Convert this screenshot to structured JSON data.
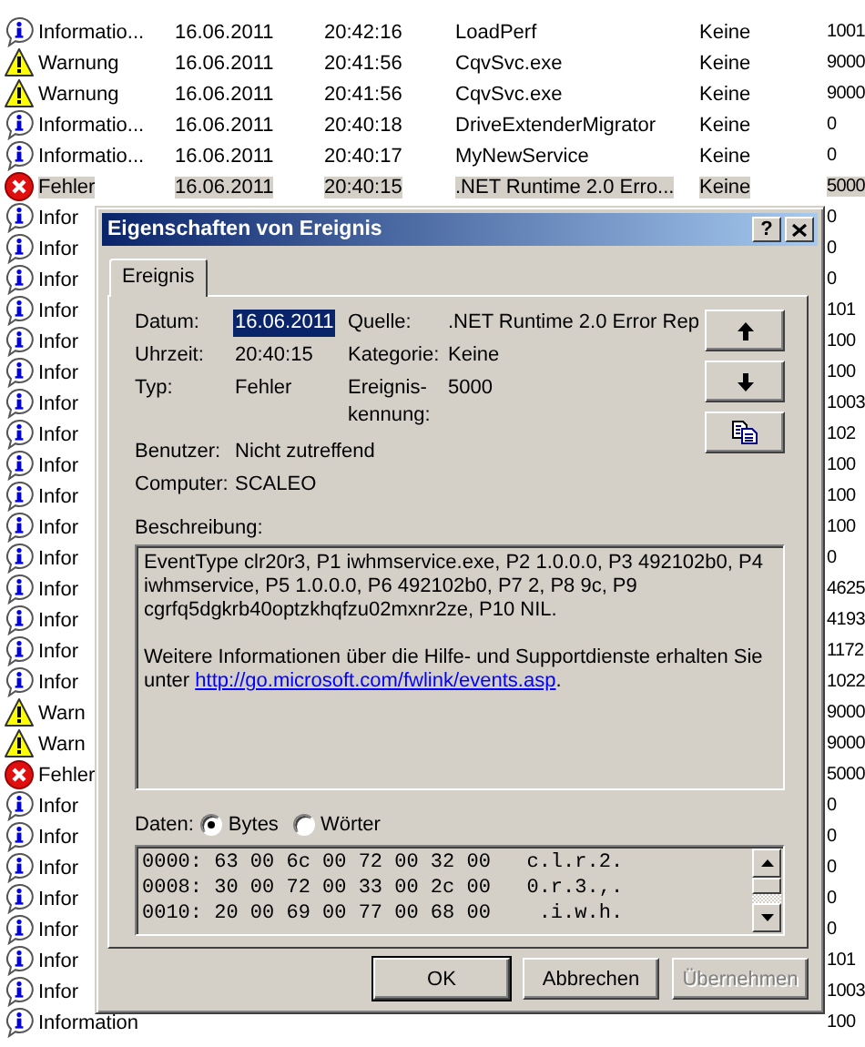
{
  "event_list": {
    "rows": [
      {
        "kind": "info",
        "type": "Informatio...",
        "date": "16.06.2011",
        "time": "20:42:16",
        "source": "LoadPerf",
        "category": "Keine",
        "id": "1001",
        "selected": false
      },
      {
        "kind": "warning",
        "type": "Warnung",
        "date": "16.06.2011",
        "time": "20:41:56",
        "source": "CqvSvc.exe",
        "category": "Keine",
        "id": "9000",
        "selected": false
      },
      {
        "kind": "warning",
        "type": "Warnung",
        "date": "16.06.2011",
        "time": "20:41:56",
        "source": "CqvSvc.exe",
        "category": "Keine",
        "id": "9000",
        "selected": false
      },
      {
        "kind": "info",
        "type": "Informatio...",
        "date": "16.06.2011",
        "time": "20:40:18",
        "source": "DriveExtenderMigrator",
        "category": "Keine",
        "id": "0",
        "selected": false
      },
      {
        "kind": "info",
        "type": "Informatio...",
        "date": "16.06.2011",
        "time": "20:40:17",
        "source": "MyNewService",
        "category": "Keine",
        "id": "0",
        "selected": false
      },
      {
        "kind": "error",
        "type": "Fehler",
        "date": "16.06.2011",
        "time": "20:40:15",
        "source": ".NET Runtime 2.0 Erro...",
        "category": "Keine",
        "id": "5000",
        "selected": true
      },
      {
        "kind": "info",
        "type": "Infor",
        "id": "0",
        "selected": false
      },
      {
        "kind": "info",
        "type": "Infor",
        "id": "0",
        "selected": false
      },
      {
        "kind": "info",
        "type": "Infor",
        "id": "0",
        "selected": false
      },
      {
        "kind": "info",
        "type": "Infor",
        "id": "101",
        "selected": false
      },
      {
        "kind": "info",
        "type": "Infor",
        "id": "100",
        "selected": false
      },
      {
        "kind": "info",
        "type": "Infor",
        "id": "100",
        "selected": false
      },
      {
        "kind": "info",
        "type": "Infor",
        "id": "1003",
        "selected": false
      },
      {
        "kind": "info",
        "type": "Infor",
        "id": "102",
        "selected": false
      },
      {
        "kind": "info",
        "type": "Infor",
        "id": "100",
        "selected": false
      },
      {
        "kind": "info",
        "type": "Infor",
        "id": "100",
        "selected": false
      },
      {
        "kind": "info",
        "type": "Infor",
        "id": "100",
        "selected": false
      },
      {
        "kind": "info",
        "type": "Infor",
        "id": "0",
        "selected": false
      },
      {
        "kind": "info",
        "type": "Infor",
        "id": "4625",
        "selected": false
      },
      {
        "kind": "info",
        "type": "Infor",
        "id": "4193",
        "selected": false
      },
      {
        "kind": "info",
        "type": "Infor",
        "id": "1172",
        "selected": false
      },
      {
        "kind": "info",
        "type": "Infor",
        "id": "1022",
        "selected": false
      },
      {
        "kind": "warning",
        "type": "Warn",
        "id": "9000",
        "selected": false
      },
      {
        "kind": "warning",
        "type": "Warn",
        "id": "9000",
        "selected": false
      },
      {
        "kind": "error",
        "type": "Fehler",
        "id": "5000",
        "selected": false
      },
      {
        "kind": "info",
        "type": "Infor",
        "id": "0",
        "selected": false
      },
      {
        "kind": "info",
        "type": "Infor",
        "id": "0",
        "selected": false
      },
      {
        "kind": "info",
        "type": "Infor",
        "id": "0",
        "selected": false
      },
      {
        "kind": "info",
        "type": "Infor",
        "id": "0",
        "selected": false
      },
      {
        "kind": "info",
        "type": "Infor",
        "id": "0",
        "selected": false
      },
      {
        "kind": "info",
        "type": "Infor",
        "id": "101",
        "selected": false
      },
      {
        "kind": "info",
        "type": "Infor",
        "id": "1003",
        "selected": false
      },
      {
        "kind": "info",
        "type": "Information",
        "id": "100",
        "selected": false
      }
    ]
  },
  "dialog": {
    "title": "Eigenschaften von Ereignis",
    "title_buttons": [
      {
        "kind": "help",
        "glyph": "?"
      },
      {
        "kind": "close"
      }
    ],
    "tabs": [
      {
        "label": "Ereignis",
        "selected": true
      }
    ],
    "fields": [
      {
        "label": "Datum:",
        "value": "16.06.2011",
        "selected": true
      },
      {
        "label": "Quelle:",
        "value": ".NET Runtime 2.0 Error Rep",
        "selected": false
      },
      {
        "label": "Uhrzeit:",
        "value": "20:40:15",
        "selected": false
      },
      {
        "label": "Kategorie:",
        "value": "Keine",
        "selected": false
      },
      {
        "label": "Typ:",
        "value": "Fehler",
        "selected": false
      },
      {
        "label": "Ereignis-kennung:",
        "value": "5000",
        "selected": false
      }
    ],
    "owner_fields": [
      {
        "label": "Benutzer:",
        "value": "Nicht zutreffend"
      },
      {
        "label": "Computer:",
        "value": "SCALEO"
      }
    ],
    "nav_buttons": [
      {
        "kind": "up"
      },
      {
        "kind": "down"
      },
      {
        "kind": "copy"
      }
    ],
    "description": {
      "label": "Beschreibung:",
      "text": "EventType clr20r3, P1 iwhmservice.exe, P2 1.0.0.0, P3 492102b0, P4 iwhmservice, P5 1.0.0.0, P6 492102b0, P7 2, P8 9c, P9 cgrfq5dgkrb40optzkhqfzu02mxnr2ze, P10 NIL.",
      "more_info": "Weitere Informationen über die Hilfe- und Supportdienste erhalten Sie unter",
      "link": "http://go.microsoft.com/fwlink/events.asp",
      "more_info_end": "."
    },
    "data": {
      "label": "Daten:",
      "options": [
        {
          "label": "Bytes",
          "selected": true
        },
        {
          "label": "Wörter",
          "selected": false
        }
      ],
      "lines": [
        "0000: 63 00 6c 00 72 00 32 00   c.l.r.2.",
        "0008: 30 00 72 00 33 00 2c 00   0.r.3.,.",
        "0010: 20 00 69 00 77 00 68 00    .i.w.h."
      ]
    },
    "buttons": [
      {
        "label": "OK",
        "default": true,
        "disabled": false
      },
      {
        "label": "Abbrechen",
        "default": false,
        "disabled": false
      },
      {
        "label": "Übernehmen",
        "default": false,
        "disabled": true
      }
    ]
  }
}
